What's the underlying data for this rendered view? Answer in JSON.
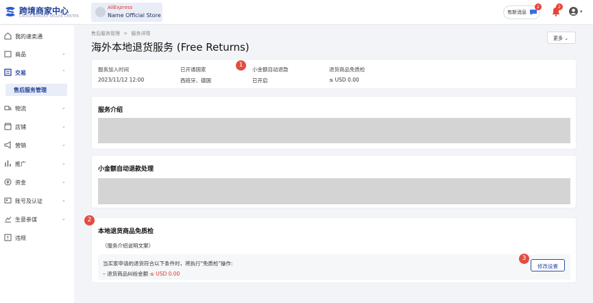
{
  "header": {
    "logo_title": "跨境商家中心",
    "logo_subtitle": "CROSS-BORDER SELLER CENTER",
    "store_brand": "AliExpress",
    "store_name": "Name Official Store",
    "messages_label": "有新消息",
    "messages_badge": "2",
    "notifications_badge": "2"
  },
  "sidebar": {
    "items": [
      {
        "label": "我的速卖通",
        "icon": "home-icon"
      },
      {
        "label": "商品",
        "icon": "product-icon"
      },
      {
        "label": "交易",
        "icon": "trade-icon"
      },
      {
        "label": "物流",
        "icon": "logistics-icon"
      },
      {
        "label": "店铺",
        "icon": "store-icon"
      },
      {
        "label": "营销",
        "icon": "marketing-icon"
      },
      {
        "label": "推广",
        "icon": "promotion-icon"
      },
      {
        "label": "资金",
        "icon": "funds-icon"
      },
      {
        "label": "账号及认证",
        "icon": "account-icon"
      },
      {
        "label": "生意参谋",
        "icon": "analytics-icon"
      },
      {
        "label": "违规",
        "icon": "violation-icon"
      }
    ],
    "sub_item": "售后服务管理"
  },
  "breadcrumb": {
    "parent": "售后服务管理",
    "separator": ">",
    "current": "服务详情"
  },
  "page": {
    "title": "海外本地退货服务 (Free Returns)",
    "more_label": "更多"
  },
  "info": {
    "join_time_label": "服务加入时间",
    "join_time_value": "2023/11/12 12:00",
    "countries_label": "已开通国家",
    "countries_value": "西班牙、德国",
    "auto_refund_label": "小金额自动退款",
    "auto_refund_value": "已开启",
    "free_check_label": "退货商品免质检",
    "free_check_value": "≤ USD 0.00"
  },
  "sections": {
    "intro_title": "服务介绍",
    "auto_title": "小金额自动退款处理",
    "local_title": "本地退货商品免质检",
    "local_desc": "（服务介绍说明文案）",
    "condition_text": "当买家申请的退货符合以下条件时，将执行\"免质检\"操作:",
    "condition_item_prefix": "– 退货商品纠纷金额",
    "condition_item_value": "≤ USD 0.00",
    "edit_label": "修改设置"
  },
  "markers": [
    "1",
    "2",
    "3"
  ]
}
